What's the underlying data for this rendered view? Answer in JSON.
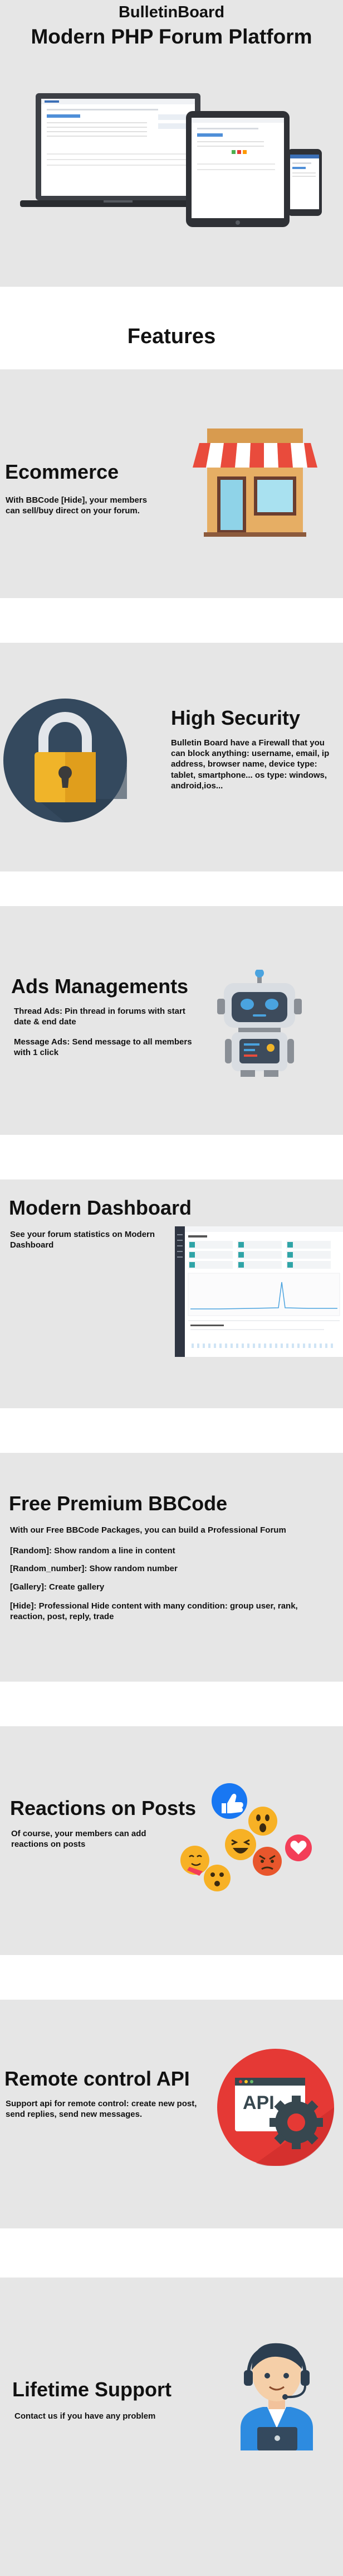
{
  "hero": {
    "brand": "BulletinBoard",
    "tagline": "Modern PHP Forum Platform"
  },
  "features_heading": "Features",
  "sections": {
    "ecommerce": {
      "title": "Ecommerce",
      "text": "With BBCode [Hide], your members can sell/buy direct on your forum."
    },
    "security": {
      "title": "High Security",
      "text": "Bulletin Board have a Firewall that you can block anything: username, email, ip address, browser name, device type: tablet, smartphone... os type: windows, android,ios..."
    },
    "ads": {
      "title": "Ads Managements",
      "text1": "Thread Ads: Pin thread in forums with start date & end date",
      "text2": "Message Ads: Send message to all members with 1 click"
    },
    "dashboard": {
      "title": "Modern Dashboard",
      "text": "See your forum statistics on Modern Dashboard"
    },
    "bbcode": {
      "title": "Free Premium BBCode",
      "intro": "With our Free BBCode Packages, you can build a Professional Forum",
      "item1": "[Random]: Show random a line in content",
      "item2": "[Random_number]: Show random number",
      "item3": "[Gallery]: Create gallery",
      "item4": "[Hide]: Professional Hide content with many condition: group user, rank, reaction, post, reply, trade"
    },
    "reactions": {
      "title": "Reactions on Posts",
      "text": "Of course, your members can add reactions on posts"
    },
    "api": {
      "title": "Remote control API",
      "text": "Support api for remote control: create new post, send replies, send new messages.",
      "badge": "API"
    },
    "support": {
      "title": "Lifetime Support",
      "text": "Contact us if you have any problem"
    }
  },
  "colors": {
    "band_bg": "#e6e6e6",
    "awning_red": "#e94b3c",
    "lock_circle": "#34495e",
    "lock_gold": "#f0b429",
    "api_red": "#e53935",
    "robot_blue": "#4aa3df"
  }
}
